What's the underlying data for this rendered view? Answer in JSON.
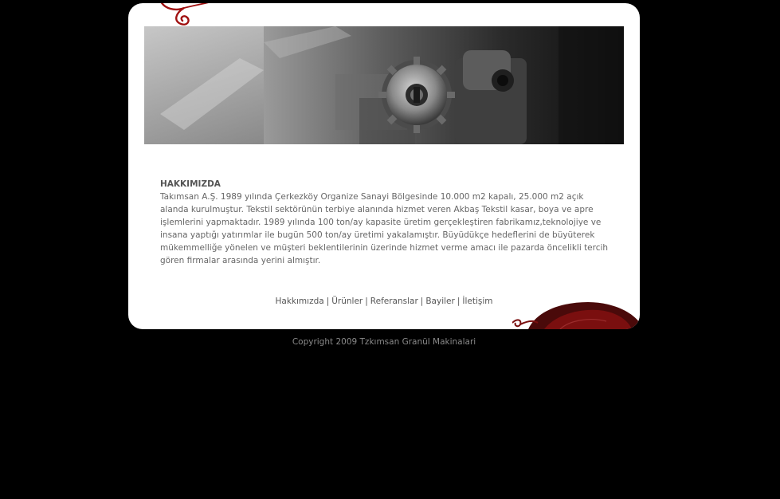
{
  "content": {
    "heading": "HAKKIMIZDA",
    "body": "Takımsan A.Ş. 1989 yılında Çerkezköy Organize Sanayi Bölgesinde 10.000 m2 kapalı, 25.000 m2 açık alanda kurulmuştur. Tekstil sektörünün terbiye alanında hizmet veren Akbaş Tekstil kasar, boya ve apre işlemlerini yapmaktadır. 1989 yılında 100 ton/ay kapasite üretim gerçekleştiren fabrikamız,teknolojiye ve insana yaptığı yatırımlar ile bugün 500 ton/ay üretimi yakalamıştır. Büyüdükçe hedeflerini de büyüterek mükemmelliğe yönelen ve müşteri beklentilerinin üzerinde hizmet verme amacı ile pazarda öncelikli tercih gören firmalar arasında yerini almıştır."
  },
  "nav": {
    "items": [
      {
        "label": "Hakkımızda"
      },
      {
        "label": "Ürünler"
      },
      {
        "label": "Referanslar"
      },
      {
        "label": "Bayiler"
      },
      {
        "label": "İletişim"
      }
    ],
    "separator": "|"
  },
  "footer": {
    "copyright": "Copyright 2009 Tzkımsan Granül Makinalari"
  },
  "colors": {
    "background": "#000000",
    "card": "#ffffff",
    "text": "#666666",
    "accent": "#8b0000"
  }
}
